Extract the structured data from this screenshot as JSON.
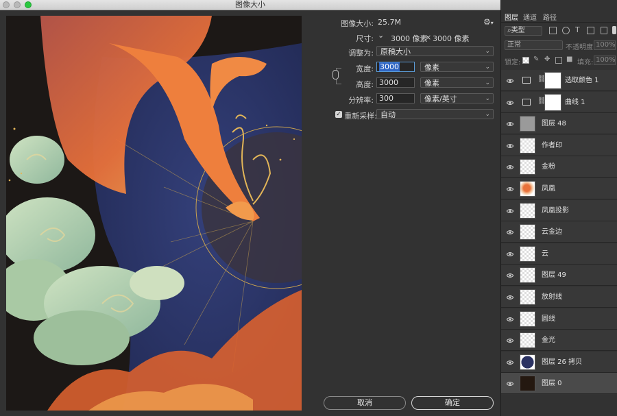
{
  "window": {
    "title": "图像大小"
  },
  "dialog": {
    "image_size_label": "图像大小:",
    "image_size_value": "25.7M",
    "dimensions_label": "尺寸:",
    "dimensions_width": "3000 像素",
    "dimensions_sep": "×",
    "dimensions_height": "3000 像素",
    "fit_to_label": "调整为:",
    "fit_to_value": "原稿大小",
    "width_label": "宽度:",
    "width_value": "3000",
    "width_unit": "像素",
    "height_label": "高度:",
    "height_value": "3000",
    "height_unit": "像素",
    "resolution_label": "分辨率:",
    "resolution_value": "300",
    "resolution_unit": "像素/英寸",
    "resample_label": "重新采样:",
    "resample_checked": true,
    "resample_value": "自动",
    "cancel_label": "取消",
    "ok_label": "确定"
  },
  "panel": {
    "tabs": [
      {
        "label": "图层"
      },
      {
        "label": "通道"
      },
      {
        "label": "路径"
      }
    ],
    "filter_placeholder": "类型",
    "blend_mode": "正常",
    "opacity_label": "不透明度:",
    "opacity_value": "100%",
    "lock_label": "锁定:",
    "fill_label": "填充:",
    "fill_value": "100%",
    "layers": [
      {
        "name": "选取颜色 1",
        "kind": "adjustment"
      },
      {
        "name": "曲线 1",
        "kind": "adjustment"
      },
      {
        "name": "图层 48",
        "kind": "gray"
      },
      {
        "name": "作者印",
        "kind": "checker"
      },
      {
        "name": "金粉",
        "kind": "checker"
      },
      {
        "name": "凤凰",
        "kind": "phoenix"
      },
      {
        "name": "凤凰投影",
        "kind": "checker"
      },
      {
        "name": "云金边",
        "kind": "checker"
      },
      {
        "name": "云",
        "kind": "cloud"
      },
      {
        "name": "图层 49",
        "kind": "checker"
      },
      {
        "name": "放射线",
        "kind": "checker"
      },
      {
        "name": "圆线",
        "kind": "checker"
      },
      {
        "name": "金光",
        "kind": "checker"
      },
      {
        "name": "图层 26 拷贝",
        "kind": "navy"
      },
      {
        "name": "图层 0",
        "kind": "dark"
      }
    ]
  },
  "colors": {
    "accent": "#2f66c4",
    "phoenix": "#e8713a",
    "night": "#2b3262",
    "cloud": "#b7d2ad"
  }
}
